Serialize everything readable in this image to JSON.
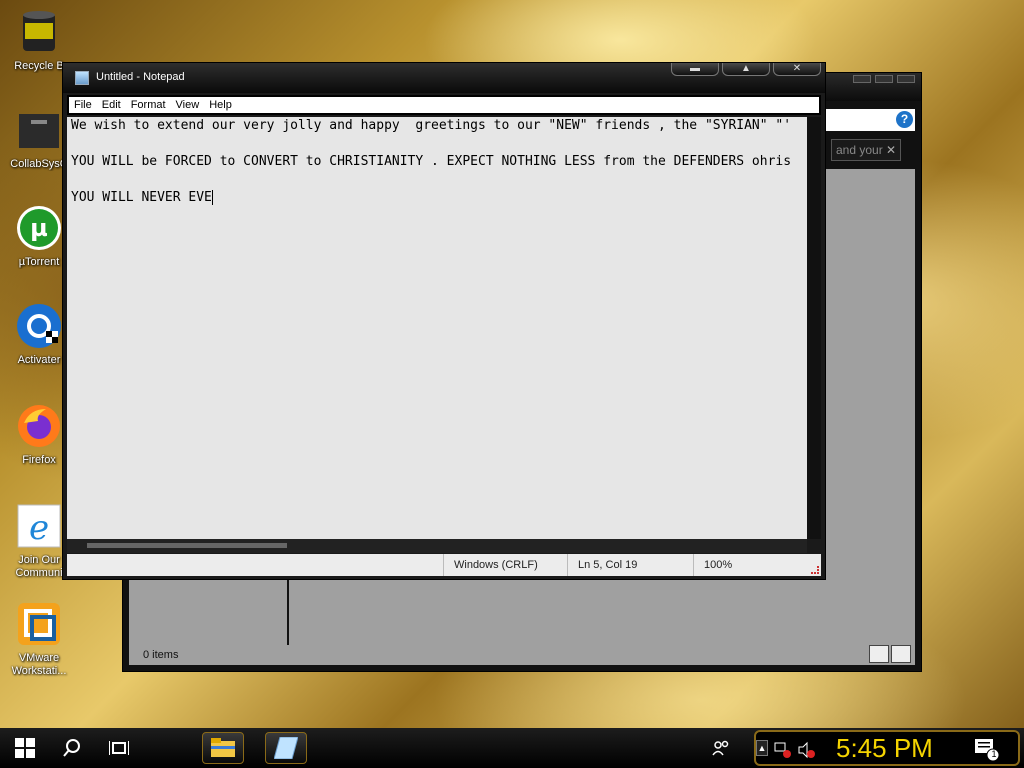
{
  "desktop": {
    "icons": [
      {
        "label": "Recycle B",
        "icon": "recycle-bin-icon"
      },
      {
        "label": "CollabSysC",
        "icon": "folder-icon"
      },
      {
        "label": "µTorrent",
        "icon": "utorrent-icon"
      },
      {
        "label": "Activater",
        "icon": "activator-icon"
      },
      {
        "label": "Firefox",
        "icon": "firefox-icon"
      },
      {
        "label": "Join Our Communi",
        "icon": "internet-explorer-icon"
      },
      {
        "label": "VMware Workstati...",
        "icon": "vmware-icon"
      }
    ]
  },
  "explorer": {
    "search_placeholder": "and your",
    "status": "0 items"
  },
  "notepad": {
    "title": "Untitled - Notepad",
    "menu": [
      "File",
      "Edit",
      "Format",
      "View",
      "Help"
    ],
    "lines": [
      "We wish to extend our very jolly and happy  greetings to our \"NEW\" friends , the \"SYRIAN\" \"'",
      "YOU WILL be FORCED to CONVERT to CHRISTIANITY . EXPECT NOTHING LESS from the DEFENDERS ohris",
      "YOU WILL NEVER EVE"
    ],
    "status": {
      "encoding": "Windows (CRLF)",
      "position": "Ln 5, Col 19",
      "zoom": "100%"
    }
  },
  "taskbar": {
    "clock": "5:45 PM",
    "notification_count": "1"
  },
  "colors": {
    "clock": "#f5d400",
    "taskbar_accent": "#8a6a18"
  }
}
